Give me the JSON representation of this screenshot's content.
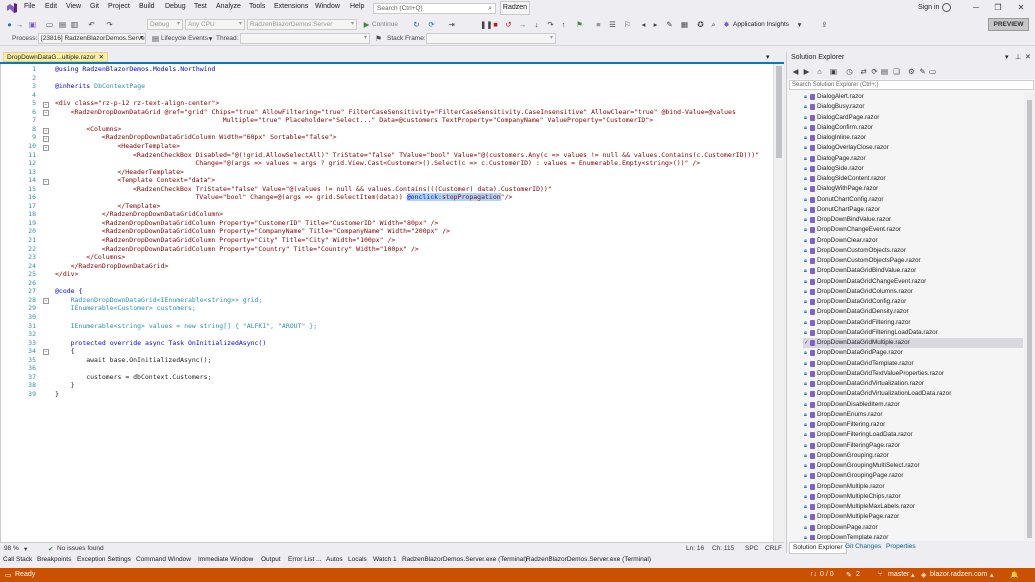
{
  "menubar": {
    "items": [
      "File",
      "Edit",
      "View",
      "Git",
      "Project",
      "Build",
      "Debug",
      "Test",
      "Analyze",
      "Tools",
      "Extensions",
      "Window",
      "Help"
    ],
    "search_placeholder": "Search (Ctrl+Q)",
    "solution_name": "Radzen",
    "sign_in": "Sign in"
  },
  "toolbar1": {
    "config": "Debug",
    "platform": "Any CPU",
    "startup_project": "RadzenBlazorDemos.Server",
    "continue_label": "Continue",
    "app_insights": "Application Insights",
    "preview": "PREVIEW"
  },
  "toolbar2": {
    "process_label": "Process:",
    "process_value": "[23816] RadzenBlazorDemos.Serve",
    "lifecycle": "Lifecycle Events",
    "thread_label": "Thread:",
    "stack_label": "Stack Frame:"
  },
  "editor": {
    "tab_title": "DropDownDataG...ultiple.razor",
    "lines": [
      {
        "n": "1"
      },
      {
        "n": "2"
      },
      {
        "n": "3"
      },
      {
        "n": "4"
      },
      {
        "n": "5"
      },
      {
        "n": "6"
      },
      {
        "n": "7"
      },
      {
        "n": "8"
      },
      {
        "n": "9"
      },
      {
        "n": "10"
      },
      {
        "n": "11"
      },
      {
        "n": "12"
      },
      {
        "n": "13"
      },
      {
        "n": "14"
      },
      {
        "n": "15"
      },
      {
        "n": "16"
      },
      {
        "n": "17"
      },
      {
        "n": "18"
      },
      {
        "n": "19"
      },
      {
        "n": "20"
      },
      {
        "n": "21"
      },
      {
        "n": "22"
      },
      {
        "n": "23"
      },
      {
        "n": "24"
      },
      {
        "n": "25"
      },
      {
        "n": "26"
      },
      {
        "n": "27"
      },
      {
        "n": "28"
      },
      {
        "n": "29"
      },
      {
        "n": "30"
      },
      {
        "n": "31"
      },
      {
        "n": "32"
      },
      {
        "n": "33"
      },
      {
        "n": "34"
      },
      {
        "n": "35"
      },
      {
        "n": "36"
      },
      {
        "n": "37"
      },
      {
        "n": "38"
      },
      {
        "n": "39"
      }
    ],
    "code": {
      "l1": "@using RadzenBlazorDemos.Models.Northwind",
      "l3a": "@inherits",
      "l3b": "DbContextPage",
      "l5": "<div class=\"rz-p-12 rz-text-align-center\">",
      "l6": "<RadzenDropDownDataGrid @ref=\"grid\" Chips=\"true\" AllowFiltering=\"true\" FilterCaseSensitivity=\"FilterCaseSensitivity.CaseInsensitive\" AllowClear=\"true\" @bind-Value=@values",
      "l7": "Multiple=\"true\" Placeholder=\"Select...\" Data=@customers TextProperty=\"CompanyName\" ValueProperty=\"CustomerID\">",
      "l8": "<Columns>",
      "l9": "<RadzenDropDownDataGridColumn Width=\"60px\" Sortable=\"false\">",
      "l10": "<HeaderTemplate>",
      "l11": "<RadzenCheckBox Disabled=\"@(!grid.AllowSelectAll)\" TriState=\"false\" TValue=\"bool\" Value=\"@(customers.Any(c => values != null && values.Contains(c.CustomerID)))\"",
      "l12": "Change=\"@(args => values = args ? grid.View.Cast<Customer>().Select(c => c.CustomerID) : values = Enumerable.Empty<string>())\" />",
      "l13": "</HeaderTemplate>",
      "l14": "<Template Context=\"data\">",
      "l15": "<RadzenCheckBox TriState=\"false\" Value=\"@(values != null && values.Contains(((Customer) data).CustomerID))\"",
      "l16a": "TValue=\"bool\" Change=@(args => grid.SelectItem(data)) ",
      "l16b": "@onclick",
      "l16c": ":stopPropagation",
      "l16d": "\"/>",
      "l17": "</Template>",
      "l18": "</RadzenDropDownDataGridColumn>",
      "l19": "<RadzenDropDownDataGridColumn Property=\"CustomerID\" Title=\"CustomerID\" Width=\"80px\" />",
      "l20": "<RadzenDropDownDataGridColumn Property=\"CompanyName\" Title=\"CompanyName\" Width=\"200px\" />",
      "l21": "<RadzenDropDownDataGridColumn Property=\"City\" Title=\"City\" Width=\"100px\" />",
      "l22": "<RadzenDropDownDataGridColumn Property=\"Country\" Title=\"Country\" Width=\"100px\" />",
      "l23": "</Columns>",
      "l24": "</RadzenDropDownDataGrid>",
      "l25": "</div>",
      "l27": "@code {",
      "l28": "RadzenDropDownDataGrid<IEnumerable<string>> grid;",
      "l29": "IEnumerable<Customer> customers;",
      "l31": "IEnumerable<string> values = new string[] { \"ALFKI\", \"AROUT\" };",
      "l33": "protected override async Task OnInitializedAsync()",
      "l34": "{",
      "l35": "await base.OnInitializedAsync();",
      "l37": "customers = dbContext.Customers;",
      "l38": "}",
      "l39": "}"
    },
    "status": {
      "zoom": "98 %",
      "issues": "No issues found",
      "ln": "Ln: 16",
      "ch": "Ch: 115",
      "spc": "SPC",
      "crlf": "CRLF"
    }
  },
  "solution_explorer": {
    "title": "Solution Explorer",
    "search_placeholder": "Search Solution Explorer (Ctrl+;)",
    "items": [
      "DialogAlert.razor",
      "DialogBusy.razor",
      "DialogCardPage.razor",
      "DialogConfirm.razor",
      "DialogInline.razor",
      "DialogOverlayClose.razor",
      "DialogPage.razor",
      "DialogSide.razor",
      "DialogSideContent.razor",
      "DialogWithPage.razor",
      "DonutChartConfig.razor",
      "DonutChartPage.razor",
      "DropDownBindValue.razor",
      "DropDownChangeEvent.razor",
      "DropDownClear.razor",
      "DropDownCustomObjects.razor",
      "DropDownCustomObjectsPage.razor",
      "DropDownDataGridBindValue.razor",
      "DropDownDataGridChangeEvent.razor",
      "DropDownDataGridColumns.razor",
      "DropDownDataGridConfig.razor",
      "DropDownDataGridDensity.razor",
      "DropDownDataGridFiltering.razor",
      "DropDownDataGridFilteringLoadData.razor",
      "DropDownDataGridMultiple.razor",
      "DropDownDataGridPage.razor",
      "DropDownDataGridTemplate.razor",
      "DropDownDataGridTextValueProperties.razor",
      "DropDownDataGridVirtualization.razor",
      "DropDownDataGridVirtualizationLoadData.razor",
      "DropDownDisabledItem.razor",
      "DropDownEnums.razor",
      "DropDownFiltering.razor",
      "DropDownFilteringLoadData.razor",
      "DropDownFilteringPage.razor",
      "DropDownGrouping.razor",
      "DropDownGroupingMultiSelect.razor",
      "DropDownGroupingPage.razor",
      "DropDownMultiple.razor",
      "DropDownMultipleChips.razor",
      "DropDownMultipleMaxLabels.razor",
      "DropDownMultiplePage.razor",
      "DropDownPage.razor",
      "DropDownTemplate.razor"
    ],
    "selected_index": 24,
    "tabs": [
      "Solution Explorer",
      "Git Changes",
      "Properties"
    ]
  },
  "tool_tabs": [
    "Call Stack",
    "Breakpoints",
    "Exception Settings",
    "Command Window",
    "Immediate Window",
    "Output",
    "Error List ...",
    "Autos",
    "Locals",
    "Watch 1",
    "RadzenBlazorDemos.Server.exe (Terminal)",
    "RadzenBlazorDemos.Server.exe (Terminal)"
  ],
  "statusbar": {
    "ready": "Ready",
    "arrows": "0 / 0",
    "pencil_count": "2",
    "branch": "master",
    "repo": "blazor.radzen.com"
  },
  "colors": {
    "accent": "#007acc",
    "statusbar": "#ca5100",
    "tab_active": "#fcefa3"
  }
}
